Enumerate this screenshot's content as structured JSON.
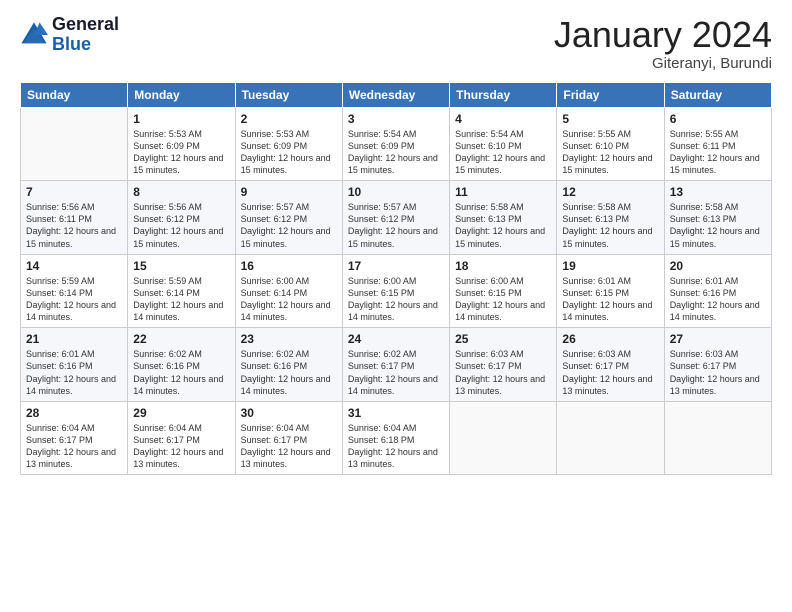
{
  "logo": {
    "line1": "General",
    "line2": "Blue"
  },
  "title": {
    "month_year": "January 2024",
    "location": "Giteranyi, Burundi"
  },
  "header_days": [
    "Sunday",
    "Monday",
    "Tuesday",
    "Wednesday",
    "Thursday",
    "Friday",
    "Saturday"
  ],
  "weeks": [
    [
      {
        "day": "",
        "sunrise": "",
        "sunset": "",
        "daylight": ""
      },
      {
        "day": "1",
        "sunrise": "Sunrise: 5:53 AM",
        "sunset": "Sunset: 6:09 PM",
        "daylight": "Daylight: 12 hours and 15 minutes."
      },
      {
        "day": "2",
        "sunrise": "Sunrise: 5:53 AM",
        "sunset": "Sunset: 6:09 PM",
        "daylight": "Daylight: 12 hours and 15 minutes."
      },
      {
        "day": "3",
        "sunrise": "Sunrise: 5:54 AM",
        "sunset": "Sunset: 6:09 PM",
        "daylight": "Daylight: 12 hours and 15 minutes."
      },
      {
        "day": "4",
        "sunrise": "Sunrise: 5:54 AM",
        "sunset": "Sunset: 6:10 PM",
        "daylight": "Daylight: 12 hours and 15 minutes."
      },
      {
        "day": "5",
        "sunrise": "Sunrise: 5:55 AM",
        "sunset": "Sunset: 6:10 PM",
        "daylight": "Daylight: 12 hours and 15 minutes."
      },
      {
        "day": "6",
        "sunrise": "Sunrise: 5:55 AM",
        "sunset": "Sunset: 6:11 PM",
        "daylight": "Daylight: 12 hours and 15 minutes."
      }
    ],
    [
      {
        "day": "7",
        "sunrise": "Sunrise: 5:56 AM",
        "sunset": "Sunset: 6:11 PM",
        "daylight": "Daylight: 12 hours and 15 minutes."
      },
      {
        "day": "8",
        "sunrise": "Sunrise: 5:56 AM",
        "sunset": "Sunset: 6:12 PM",
        "daylight": "Daylight: 12 hours and 15 minutes."
      },
      {
        "day": "9",
        "sunrise": "Sunrise: 5:57 AM",
        "sunset": "Sunset: 6:12 PM",
        "daylight": "Daylight: 12 hours and 15 minutes."
      },
      {
        "day": "10",
        "sunrise": "Sunrise: 5:57 AM",
        "sunset": "Sunset: 6:12 PM",
        "daylight": "Daylight: 12 hours and 15 minutes."
      },
      {
        "day": "11",
        "sunrise": "Sunrise: 5:58 AM",
        "sunset": "Sunset: 6:13 PM",
        "daylight": "Daylight: 12 hours and 15 minutes."
      },
      {
        "day": "12",
        "sunrise": "Sunrise: 5:58 AM",
        "sunset": "Sunset: 6:13 PM",
        "daylight": "Daylight: 12 hours and 15 minutes."
      },
      {
        "day": "13",
        "sunrise": "Sunrise: 5:58 AM",
        "sunset": "Sunset: 6:13 PM",
        "daylight": "Daylight: 12 hours and 15 minutes."
      }
    ],
    [
      {
        "day": "14",
        "sunrise": "Sunrise: 5:59 AM",
        "sunset": "Sunset: 6:14 PM",
        "daylight": "Daylight: 12 hours and 14 minutes."
      },
      {
        "day": "15",
        "sunrise": "Sunrise: 5:59 AM",
        "sunset": "Sunset: 6:14 PM",
        "daylight": "Daylight: 12 hours and 14 minutes."
      },
      {
        "day": "16",
        "sunrise": "Sunrise: 6:00 AM",
        "sunset": "Sunset: 6:14 PM",
        "daylight": "Daylight: 12 hours and 14 minutes."
      },
      {
        "day": "17",
        "sunrise": "Sunrise: 6:00 AM",
        "sunset": "Sunset: 6:15 PM",
        "daylight": "Daylight: 12 hours and 14 minutes."
      },
      {
        "day": "18",
        "sunrise": "Sunrise: 6:00 AM",
        "sunset": "Sunset: 6:15 PM",
        "daylight": "Daylight: 12 hours and 14 minutes."
      },
      {
        "day": "19",
        "sunrise": "Sunrise: 6:01 AM",
        "sunset": "Sunset: 6:15 PM",
        "daylight": "Daylight: 12 hours and 14 minutes."
      },
      {
        "day": "20",
        "sunrise": "Sunrise: 6:01 AM",
        "sunset": "Sunset: 6:16 PM",
        "daylight": "Daylight: 12 hours and 14 minutes."
      }
    ],
    [
      {
        "day": "21",
        "sunrise": "Sunrise: 6:01 AM",
        "sunset": "Sunset: 6:16 PM",
        "daylight": "Daylight: 12 hours and 14 minutes."
      },
      {
        "day": "22",
        "sunrise": "Sunrise: 6:02 AM",
        "sunset": "Sunset: 6:16 PM",
        "daylight": "Daylight: 12 hours and 14 minutes."
      },
      {
        "day": "23",
        "sunrise": "Sunrise: 6:02 AM",
        "sunset": "Sunset: 6:16 PM",
        "daylight": "Daylight: 12 hours and 14 minutes."
      },
      {
        "day": "24",
        "sunrise": "Sunrise: 6:02 AM",
        "sunset": "Sunset: 6:17 PM",
        "daylight": "Daylight: 12 hours and 14 minutes."
      },
      {
        "day": "25",
        "sunrise": "Sunrise: 6:03 AM",
        "sunset": "Sunset: 6:17 PM",
        "daylight": "Daylight: 12 hours and 13 minutes."
      },
      {
        "day": "26",
        "sunrise": "Sunrise: 6:03 AM",
        "sunset": "Sunset: 6:17 PM",
        "daylight": "Daylight: 12 hours and 13 minutes."
      },
      {
        "day": "27",
        "sunrise": "Sunrise: 6:03 AM",
        "sunset": "Sunset: 6:17 PM",
        "daylight": "Daylight: 12 hours and 13 minutes."
      }
    ],
    [
      {
        "day": "28",
        "sunrise": "Sunrise: 6:04 AM",
        "sunset": "Sunset: 6:17 PM",
        "daylight": "Daylight: 12 hours and 13 minutes."
      },
      {
        "day": "29",
        "sunrise": "Sunrise: 6:04 AM",
        "sunset": "Sunset: 6:17 PM",
        "daylight": "Daylight: 12 hours and 13 minutes."
      },
      {
        "day": "30",
        "sunrise": "Sunrise: 6:04 AM",
        "sunset": "Sunset: 6:17 PM",
        "daylight": "Daylight: 12 hours and 13 minutes."
      },
      {
        "day": "31",
        "sunrise": "Sunrise: 6:04 AM",
        "sunset": "Sunset: 6:18 PM",
        "daylight": "Daylight: 12 hours and 13 minutes."
      },
      {
        "day": "",
        "sunrise": "",
        "sunset": "",
        "daylight": ""
      },
      {
        "day": "",
        "sunrise": "",
        "sunset": "",
        "daylight": ""
      },
      {
        "day": "",
        "sunrise": "",
        "sunset": "",
        "daylight": ""
      }
    ]
  ]
}
